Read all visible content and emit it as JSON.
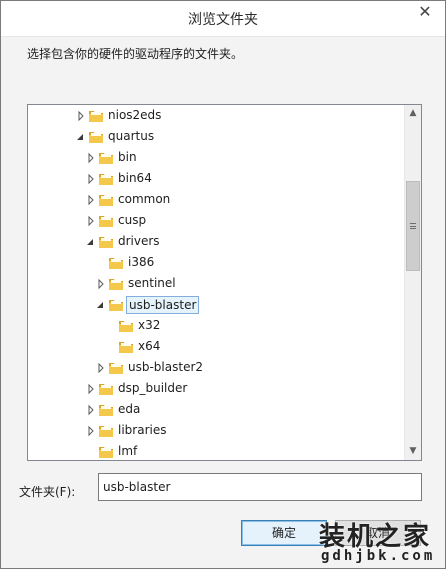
{
  "window": {
    "title": "浏览文件夹",
    "close_label": "✕"
  },
  "instruction": "选择包含你的硬件的驱动程序的文件夹。",
  "tree": {
    "rows": [
      {
        "label": "nios2eds",
        "level": 0,
        "expander": "collapsed",
        "selected": false
      },
      {
        "label": "quartus",
        "level": 0,
        "expander": "expanded",
        "selected": false
      },
      {
        "label": "bin",
        "level": 1,
        "expander": "collapsed",
        "selected": false
      },
      {
        "label": "bin64",
        "level": 1,
        "expander": "collapsed",
        "selected": false
      },
      {
        "label": "common",
        "level": 1,
        "expander": "collapsed",
        "selected": false
      },
      {
        "label": "cusp",
        "level": 1,
        "expander": "collapsed",
        "selected": false
      },
      {
        "label": "drivers",
        "level": 1,
        "expander": "expanded",
        "selected": false
      },
      {
        "label": "i386",
        "level": 2,
        "expander": "none",
        "selected": false
      },
      {
        "label": "sentinel",
        "level": 2,
        "expander": "collapsed",
        "selected": false
      },
      {
        "label": "usb-blaster",
        "level": 2,
        "expander": "expanded",
        "selected": true
      },
      {
        "label": "x32",
        "level": 3,
        "expander": "none",
        "selected": false
      },
      {
        "label": "x64",
        "level": 3,
        "expander": "none",
        "selected": false
      },
      {
        "label": "usb-blaster2",
        "level": 2,
        "expander": "collapsed",
        "selected": false
      },
      {
        "label": "dsp_builder",
        "level": 1,
        "expander": "collapsed",
        "selected": false
      },
      {
        "label": "eda",
        "level": 1,
        "expander": "collapsed",
        "selected": false
      },
      {
        "label": "libraries",
        "level": 1,
        "expander": "collapsed",
        "selected": false
      },
      {
        "label": "lmf",
        "level": 1,
        "expander": "none",
        "selected": false
      }
    ]
  },
  "folder_field": {
    "label": "文件夹(F):",
    "value": "usb-blaster"
  },
  "buttons": {
    "ok": "确定",
    "cancel": "取消"
  },
  "watermark": {
    "main": "装机之家",
    "sub": "gdhjbk.com"
  },
  "colors": {
    "folder_fill": "#f3c84b",
    "folder_dark": "#d9a52a",
    "selection_bg": "#e5f3fb",
    "selection_border": "#84acdd"
  }
}
